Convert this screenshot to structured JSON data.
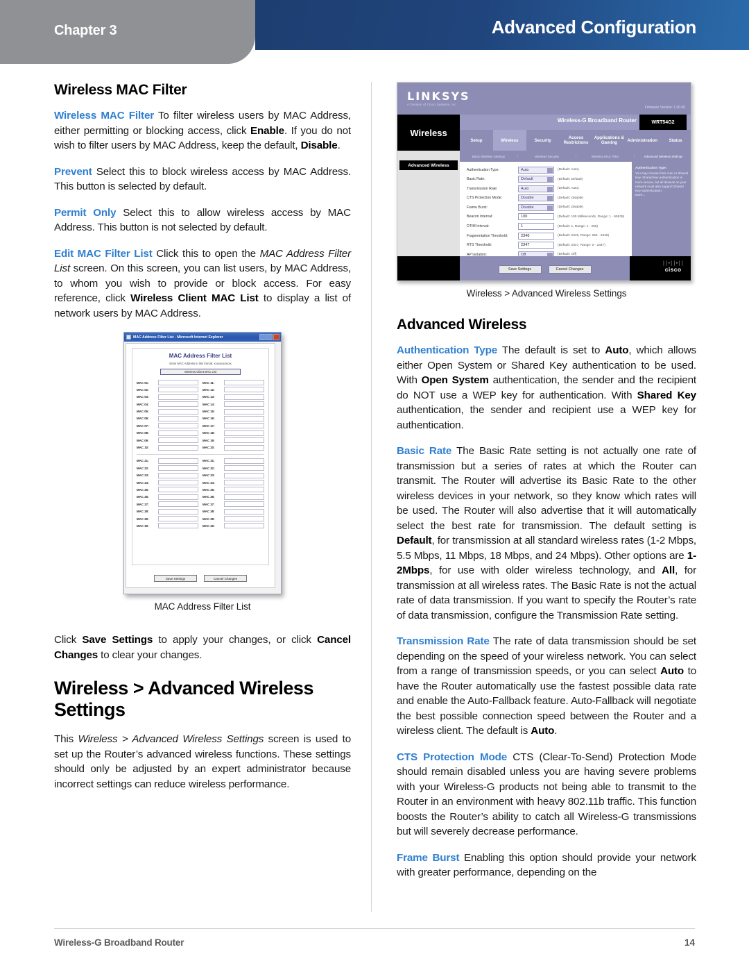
{
  "header": {
    "chapter": "Chapter 3",
    "title": "Advanced Configuration"
  },
  "left_column": {
    "heading": "Wireless MAC Filter",
    "p1": {
      "term": "Wireless MAC Filter",
      "text_a": "  To filter wireless users by MAC Address, either permitting or blocking access, click ",
      "bold_a": "Enable",
      "text_b": ". If you do not wish to filter users by MAC Address, keep the default, ",
      "bold_b": "Disable",
      "text_c": "."
    },
    "p2": {
      "term": "Prevent",
      "text_a": " Select this to block wireless access by MAC Address. This button is selected by default."
    },
    "p3": {
      "term": "Permit Only",
      "text_a": "  Select this to allow wireless access by MAC Address. This button is not selected by default."
    },
    "p4": {
      "term": "Edit MAC Filter List",
      "text_a": " Click this to open the ",
      "italic_a": "MAC Address Filter List",
      "text_b": " screen. On this screen, you can list users, by MAC Address, to whom you wish to provide or block access. For easy reference, click ",
      "bold_a": "Wireless Client MAC List",
      "text_c": " to display a list of network users by MAC Address."
    },
    "figure_caption": "MAC Address Filter List",
    "p5": {
      "text_a": "Click ",
      "bold_a": "Save Settings",
      "text_b": " to apply your changes, or click ",
      "bold_b": "Cancel Changes",
      "text_c": " to clear your changes."
    },
    "heading2": "Wireless > Advanced Wireless Settings",
    "p6": {
      "text_a": "This ",
      "italic_a": "Wireless > Advanced Wireless Settings",
      "text_b": " screen is used to set up the Router’s advanced wireless functions. These settings should only be adjusted by an expert administrator because incorrect settings can reduce wireless performance."
    }
  },
  "mac_filter_screenshot": {
    "window_title": "MAC Address Filter List - Microsoft Internet Explorer",
    "page_title": "MAC Address Filter List",
    "instruction": "Enter MAC Address in this format: xxxxxxxxxxxx",
    "client_list_button": "Wireless Client MAC List",
    "field_labels_group1_left": [
      "MAC 01:",
      "MAC 02:",
      "MAC 03:",
      "MAC 04:",
      "MAC 05:",
      "MAC 06:",
      "MAC 07:",
      "MAC 08:",
      "MAC 09:",
      "MAC 10:"
    ],
    "field_labels_group1_right": [
      "MAC 11:",
      "MAC 12:",
      "MAC 13:",
      "MAC 14:",
      "MAC 15:",
      "MAC 16:",
      "MAC 17:",
      "MAC 18:",
      "MAC 19:",
      "MAC 20:"
    ],
    "field_labels_group2_left": [
      "MAC 21:",
      "MAC 22:",
      "MAC 23:",
      "MAC 24:",
      "MAC 25:",
      "MAC 26:",
      "MAC 27:",
      "MAC 28:",
      "MAC 29:",
      "MAC 30:"
    ],
    "field_labels_group2_right": [
      "MAC 31:",
      "MAC 32:",
      "MAC 33:",
      "MAC 34:",
      "MAC 35:",
      "MAC 36:",
      "MAC 37:",
      "MAC 38:",
      "MAC 39:",
      "MAC 40:"
    ],
    "save_button": "Save Settings",
    "cancel_button": "Cancel Changes"
  },
  "router_screenshot": {
    "brand": "LINKSYS",
    "brand_sub": "A Division of Cisco Systems, Inc.",
    "firmware": "Firmware Version: 1.00.00",
    "model_name": "Wireless-G Broadband Router",
    "model_number": "WRT54G2",
    "section_title": "Wireless",
    "tabs": [
      "Setup",
      "Wireless",
      "Security",
      "Access Restrictions",
      "Applications & Gaming",
      "Administration",
      "Status"
    ],
    "subtabs": [
      "Basic Wireless Settings",
      "Wireless Security",
      "Wireless MAC Filter",
      "Advanced Wireless Settings"
    ],
    "panel_heading": "Advanced Wireless",
    "settings": [
      {
        "label": "Authentication Type:",
        "value": "Auto",
        "kind": "select",
        "hint": "(Default: Auto)"
      },
      {
        "label": "Basic Rate:",
        "value": "Default",
        "kind": "select",
        "hint": "(Default: Default)"
      },
      {
        "label": "Transmission Rate:",
        "value": "Auto",
        "kind": "select",
        "hint": "(Default: Auto)"
      },
      {
        "label": "CTS Protection Mode:",
        "value": "Disable",
        "kind": "select",
        "hint": "(Default: Disable)"
      },
      {
        "label": "Frame Burst:",
        "value": "Disable",
        "kind": "select",
        "hint": "(Default: Disable)"
      },
      {
        "label": "Beacon Interval:",
        "value": "100",
        "kind": "input",
        "hint": "(Default: 100 Milliseconds, Range: 1 - 65535)"
      },
      {
        "label": "DTIM Interval:",
        "value": "1",
        "kind": "input",
        "hint": "(Default: 1, Range: 1 - 255)"
      },
      {
        "label": "Fragmentation Threshold:",
        "value": "2346",
        "kind": "input",
        "hint": "(Default: 2346, Range: 256 - 2346)"
      },
      {
        "label": "RTS Threshold:",
        "value": "2347",
        "kind": "input",
        "hint": "(Default: 2347, Range: 0 - 2347)"
      },
      {
        "label": "AP Isolation:",
        "value": "Off",
        "kind": "select",
        "hint": "(Default: Off)"
      }
    ],
    "help_title": "Authentication Type:",
    "help_text": "You may choose from Auto or Shared Key. Shared key authentication is more secure, but all devices on your network must also support Shared Key authentication.",
    "help_more": "More...",
    "save_button": "Save Settings",
    "cancel_button": "Cancel Changes",
    "cisco_bars": "││•││•││",
    "cisco_word": "cisco",
    "caption": "Wireless > Advanced Wireless Settings"
  },
  "right_column": {
    "heading": "Advanced Wireless",
    "p1": {
      "term": "Authentication Type",
      "text_a": "  The default is set to ",
      "bold_a": "Auto",
      "text_b": ", which allows either Open System or Shared Key authentication to be used. With ",
      "bold_b": "Open System",
      "text_c": " authentication, the sender and the recipient do NOT use a WEP key for authentication. With ",
      "bold_c": "Shared Key",
      "text_d": " authentication, the sender and recipient use a WEP key for authentication."
    },
    "p2": {
      "term": "Basic Rate",
      "text_a": "  The Basic Rate setting is not actually one rate of transmission but a series of rates at which the Router can transmit. The Router will advertise its Basic Rate to the other wireless devices in your network, so they know which rates will be used. The Router will also advertise that it will automatically select the best rate for transmission. The default setting is ",
      "bold_a": "Default",
      "text_b": ", for transmission at all standard wireless rates (1-2 Mbps, 5.5 Mbps, 11 Mbps, 18 Mbps, and 24 Mbps). Other options are ",
      "bold_b": "1-2Mbps",
      "text_c": ", for use with older wireless technology, and ",
      "bold_c": "All",
      "text_d": ", for transmission at all wireless rates. The Basic Rate is not the actual rate of data transmission. If you want to specify the Router’s rate of data transmission, configure the Transmission Rate setting."
    },
    "p3": {
      "term": "Transmission Rate",
      "text_a": "  The rate of data transmission should be set depending on the speed of your wireless network. You can select from a range of transmission speeds, or you can select ",
      "bold_a": "Auto",
      "text_b": " to have the Router automatically use the fastest possible data rate and enable the Auto-Fallback feature. Auto-Fallback will negotiate the best possible connection speed between the Router and a wireless client. The default is ",
      "bold_b": "Auto",
      "text_c": "."
    },
    "p4": {
      "term": "CTS Protection Mode",
      "text_a": " CTS (Clear-To-Send) Protection Mode should remain disabled unless you are having severe problems with your Wireless-G products not being able to transmit to the Router in an environment with heavy 802.11b traffic. This function boosts the Router’s ability to catch all Wireless-G transmissions but will severely decrease performance."
    },
    "p5": {
      "term": "Frame Burst",
      "text_a": " Enabling this option should provide your network with greater performance, depending on the"
    }
  },
  "footer": {
    "left": "Wireless-G Broadband Router",
    "page_number": "14"
  },
  "colors": {
    "term_blue": "#2f7fd0",
    "header_blue_dark": "#1d3e70",
    "header_blue_light": "#2b6bab",
    "header_gray": "#8f9194",
    "router_purple": "#8c8cb4"
  }
}
